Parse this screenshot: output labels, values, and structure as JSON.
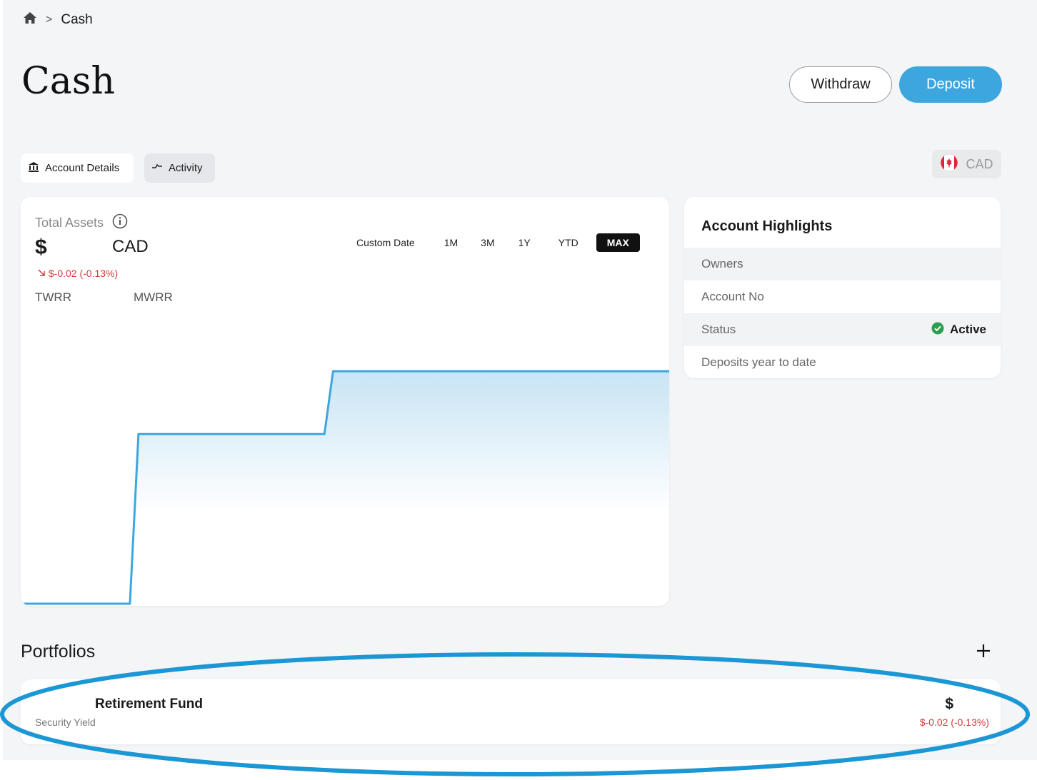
{
  "breadcrumb": {
    "home_icon": "home-icon",
    "separator": ">",
    "current": "Cash"
  },
  "page": {
    "title": "Cash"
  },
  "actions": {
    "withdraw_label": "Withdraw",
    "deposit_label": "Deposit"
  },
  "tabs": [
    {
      "label": "Account Details",
      "icon": "bank-icon",
      "active": true
    },
    {
      "label": "Activity",
      "icon": "activity-icon",
      "active": false
    }
  ],
  "currency_selector": {
    "flag": "canada-flag-icon",
    "label": "CAD"
  },
  "total_assets": {
    "label": "Total Assets",
    "value": "$",
    "currency": "CAD",
    "change": "$-0.02 (-0.13%)",
    "metrics": [
      "TWRR",
      "MWRR"
    ]
  },
  "time_ranges": [
    {
      "label": "Custom Date",
      "active": false
    },
    {
      "label": "1M",
      "active": false
    },
    {
      "label": "3M",
      "active": false
    },
    {
      "label": "1Y",
      "active": false
    },
    {
      "label": "YTD",
      "active": false
    },
    {
      "label": "MAX",
      "active": true
    }
  ],
  "chart_data": {
    "type": "area",
    "title": "",
    "xlabel": "",
    "ylabel": "",
    "grid": false,
    "series": [
      {
        "values": [
          0,
          0,
          0,
          0,
          0.73,
          0.73,
          0.73,
          0.73,
          0.73,
          0.73,
          1.0,
          1.0,
          1.0,
          1.0,
          1.0,
          1.0,
          1.0,
          1.0,
          1.0,
          1.0,
          1.0
        ]
      }
    ],
    "ylim": [
      0,
      1.05
    ],
    "colors": {
      "line": "#3da6df",
      "fill": "#cde6f5"
    }
  },
  "account_highlights": {
    "title": "Account Highlights",
    "rows": [
      {
        "label": "Owners",
        "value": ""
      },
      {
        "label": "Account No",
        "value": ""
      },
      {
        "label": "Status",
        "value": "Active",
        "icon": "check-circle-icon"
      },
      {
        "label": "Deposits year to date",
        "value": ""
      }
    ]
  },
  "portfolios": {
    "title": "Portfolios",
    "add_icon": "plus-icon",
    "items": [
      {
        "name": "Retirement Fund",
        "subtitle": "Security Yield",
        "value": "$",
        "change": "$-0.02 (-0.13%)"
      }
    ]
  },
  "colors": {
    "accent": "#3da6df",
    "negative": "#d63b3b",
    "active_status": "#2e9e4f",
    "annotation": "#1a97d4"
  }
}
